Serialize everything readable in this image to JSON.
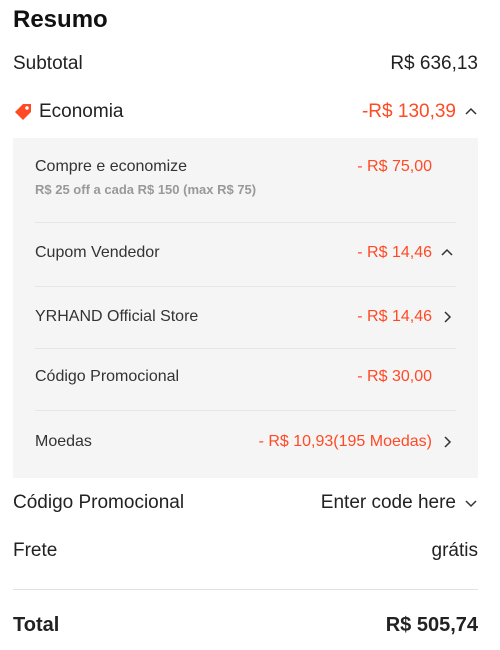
{
  "summary": {
    "title": "Resumo",
    "subtotal_label": "Subtotal",
    "subtotal_value": "R$ 636,13",
    "saving_label": "Economia",
    "saving_value": "-R$ 130,39",
    "accent_color": "#ff4a25"
  },
  "panel": {
    "items": [
      {
        "label": "Compre e economize",
        "value": "- R$ 75,00",
        "note": "R$ 25 off a cada R$ 150 (max R$ 75)"
      },
      {
        "label": "Cupom Vendedor",
        "value": "- R$ 14,46"
      },
      {
        "label": "YRHAND Official Store",
        "value": "- R$ 14,46"
      },
      {
        "label": "Código Promocional",
        "value": "- R$ 30,00"
      },
      {
        "label": "Moedas",
        "value": "- R$ 10,93(195 Moedas)"
      }
    ]
  },
  "promo": {
    "label": "Código Promocional",
    "value": "Enter code here"
  },
  "shipping": {
    "label": "Frete",
    "value": "grátis"
  },
  "total": {
    "label": "Total",
    "value": "R$ 505,74"
  }
}
